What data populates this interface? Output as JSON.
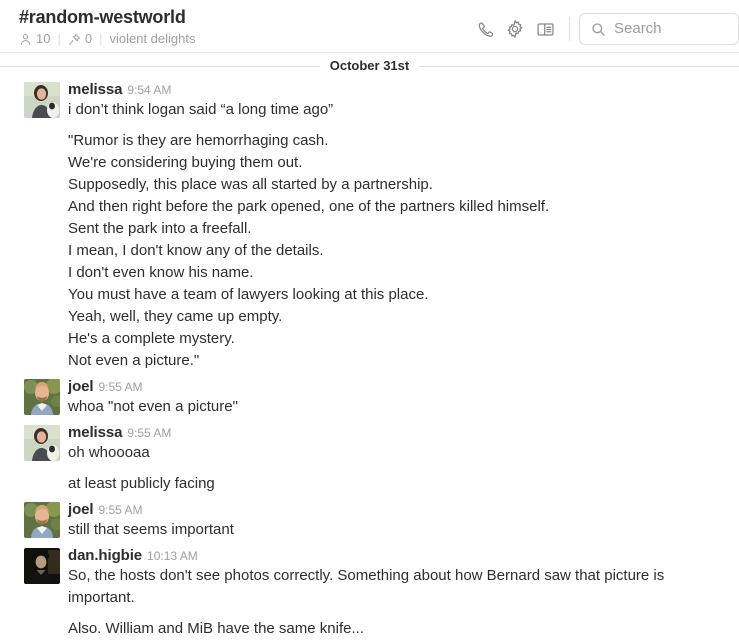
{
  "header": {
    "channel_name": "#random-westworld",
    "members_count": "10",
    "pins_count": "0",
    "topic": "violent delights",
    "separator": "|",
    "icons": {
      "members": "person-icon",
      "pins": "pin-icon",
      "call": "phone-icon",
      "settings": "gear-icon",
      "details": "side-panel-icon",
      "search": "search-icon"
    },
    "actions": {
      "call_label": "Call",
      "settings_label": "Settings",
      "details_label": "Show channel details"
    },
    "search": {
      "placeholder": "Search",
      "value": ""
    }
  },
  "divider": {
    "date_label": "October 31st"
  },
  "messages": [
    {
      "author": "melissa",
      "time": "9:54 AM",
      "avatar": "melissa-avatar",
      "continuation": false,
      "paragraphs": [
        "i don’t think logan said “a long time ago”",
        "\"Rumor is they are hemorrhaging cash.\nWe're considering buying them out.\nSupposedly, this place was all started by a partnership.\nAnd then right before the park opened, one of the partners killed himself.\nSent the park into a freefall.\nI mean, I don't know any of the details.\nI don't even know his name.\nYou must have a team of lawyers looking at this place.\nYeah, well, they came up empty.\nHe's a complete mystery.\nNot even a picture.\""
      ]
    },
    {
      "author": "joel",
      "time": "9:55 AM",
      "avatar": "joel-avatar",
      "continuation": false,
      "paragraphs": [
        "whoa \"not even a picture\""
      ]
    },
    {
      "author": "melissa",
      "time": "9:55 AM",
      "avatar": "melissa-avatar",
      "continuation": false,
      "paragraphs": [
        "oh whoooaa",
        "at least publicly facing"
      ]
    },
    {
      "author": "joel",
      "time": "9:55 AM",
      "avatar": "joel-avatar",
      "continuation": false,
      "paragraphs": [
        "still that seems important"
      ]
    },
    {
      "author": "dan.higbie",
      "time": "10:13 AM",
      "avatar": "dan-higbie-avatar",
      "continuation": false,
      "paragraphs": [
        "So, the hosts don't see photos correctly. Something about how Bernard saw that picture is important.",
        "Also. William and MiB have the same knife..."
      ]
    }
  ],
  "colors": {
    "text": "#2c2d30",
    "muted": "#9e9ea6",
    "border": "#e0e0e0",
    "background": "#ffffff"
  }
}
